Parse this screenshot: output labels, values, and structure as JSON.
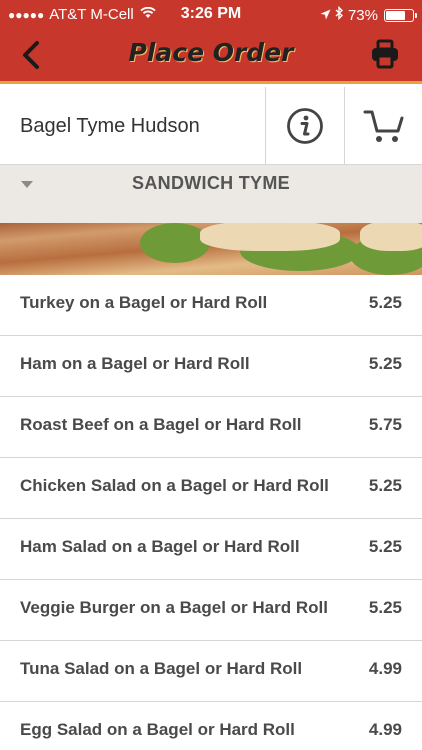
{
  "status_bar": {
    "signal_dots": "●●●●●",
    "carrier": "AT&T M-Cell",
    "time": "3:26 PM",
    "battery_percent": "73%",
    "battery_level": 0.73
  },
  "nav": {
    "title": "Place Order",
    "back_icon": "chevron-left-icon",
    "print_icon": "printer-icon"
  },
  "store": {
    "name": "Bagel Tyme Hudson",
    "info_icon": "info-icon",
    "cart_icon": "cart-icon"
  },
  "category": {
    "title": "SANDWICH TYME"
  },
  "menu_items": [
    {
      "name": "Turkey on a Bagel or Hard Roll",
      "price": "5.25"
    },
    {
      "name": "Ham on a Bagel or Hard Roll",
      "price": "5.25"
    },
    {
      "name": "Roast Beef on a Bagel or Hard Roll",
      "price": "5.75"
    },
    {
      "name": "Chicken Salad on a Bagel or Hard Roll",
      "price": "5.25"
    },
    {
      "name": "Ham Salad on a Bagel or Hard Roll",
      "price": "5.25"
    },
    {
      "name": "Veggie Burger on a Bagel or Hard Roll",
      "price": "5.25"
    },
    {
      "name": "Tuna Salad on a Bagel or Hard Roll",
      "price": "4.99"
    },
    {
      "name": "Egg Salad on a Bagel or Hard Roll",
      "price": "4.99"
    }
  ],
  "colors": {
    "header_red": "#c8372b",
    "header_accent": "#e8a23a"
  }
}
